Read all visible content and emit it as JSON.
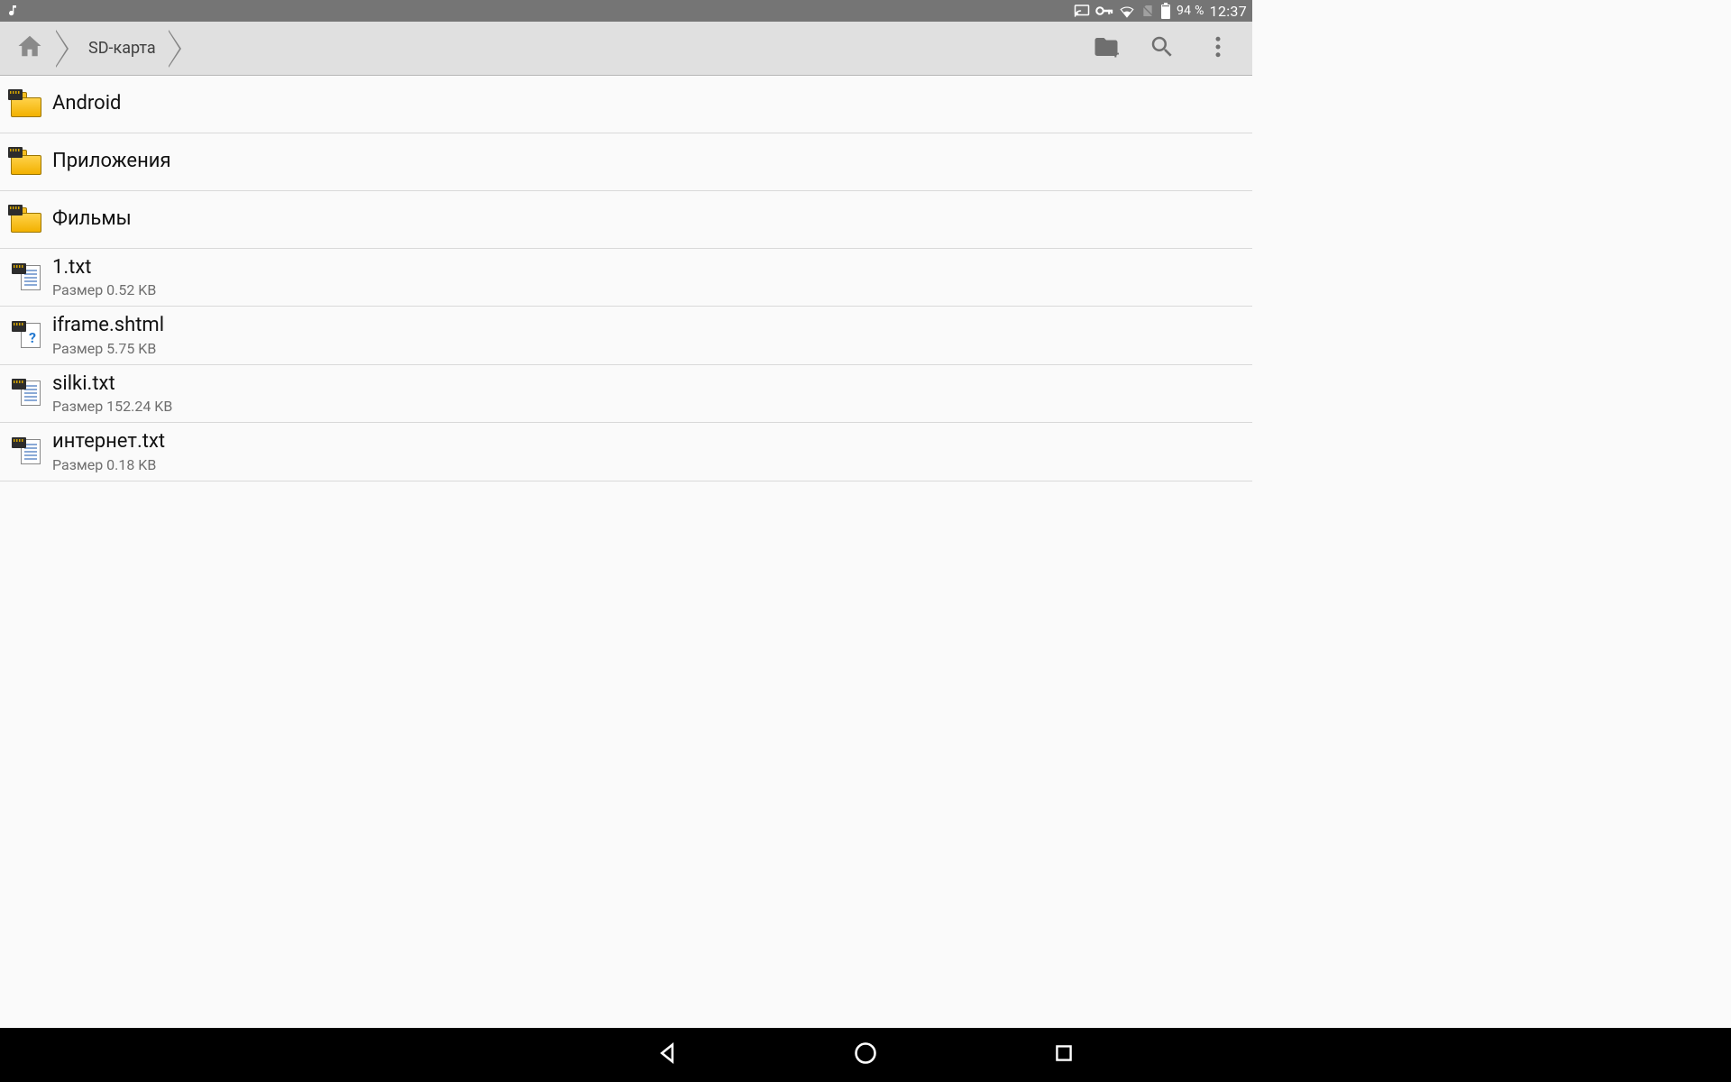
{
  "status": {
    "battery_text": "94 %",
    "clock": "12:37"
  },
  "breadcrumb": {
    "current": "SD-карта"
  },
  "entries": [
    {
      "type": "folder",
      "name": "Android"
    },
    {
      "type": "folder",
      "name": "Приложения"
    },
    {
      "type": "folder",
      "name": "Фильмы"
    },
    {
      "type": "file",
      "name": "1.txt",
      "size_line": "Размер 0.52 KB",
      "kind": "text"
    },
    {
      "type": "file",
      "name": "iframe.shtml",
      "size_line": "Размер 5.75 KB",
      "kind": "unknown"
    },
    {
      "type": "file",
      "name": "silki.txt",
      "size_line": "Размер 152.24 KB",
      "kind": "text"
    },
    {
      "type": "file",
      "name": "интернет.txt",
      "size_line": "Размер 0.18 KB",
      "kind": "text"
    }
  ]
}
